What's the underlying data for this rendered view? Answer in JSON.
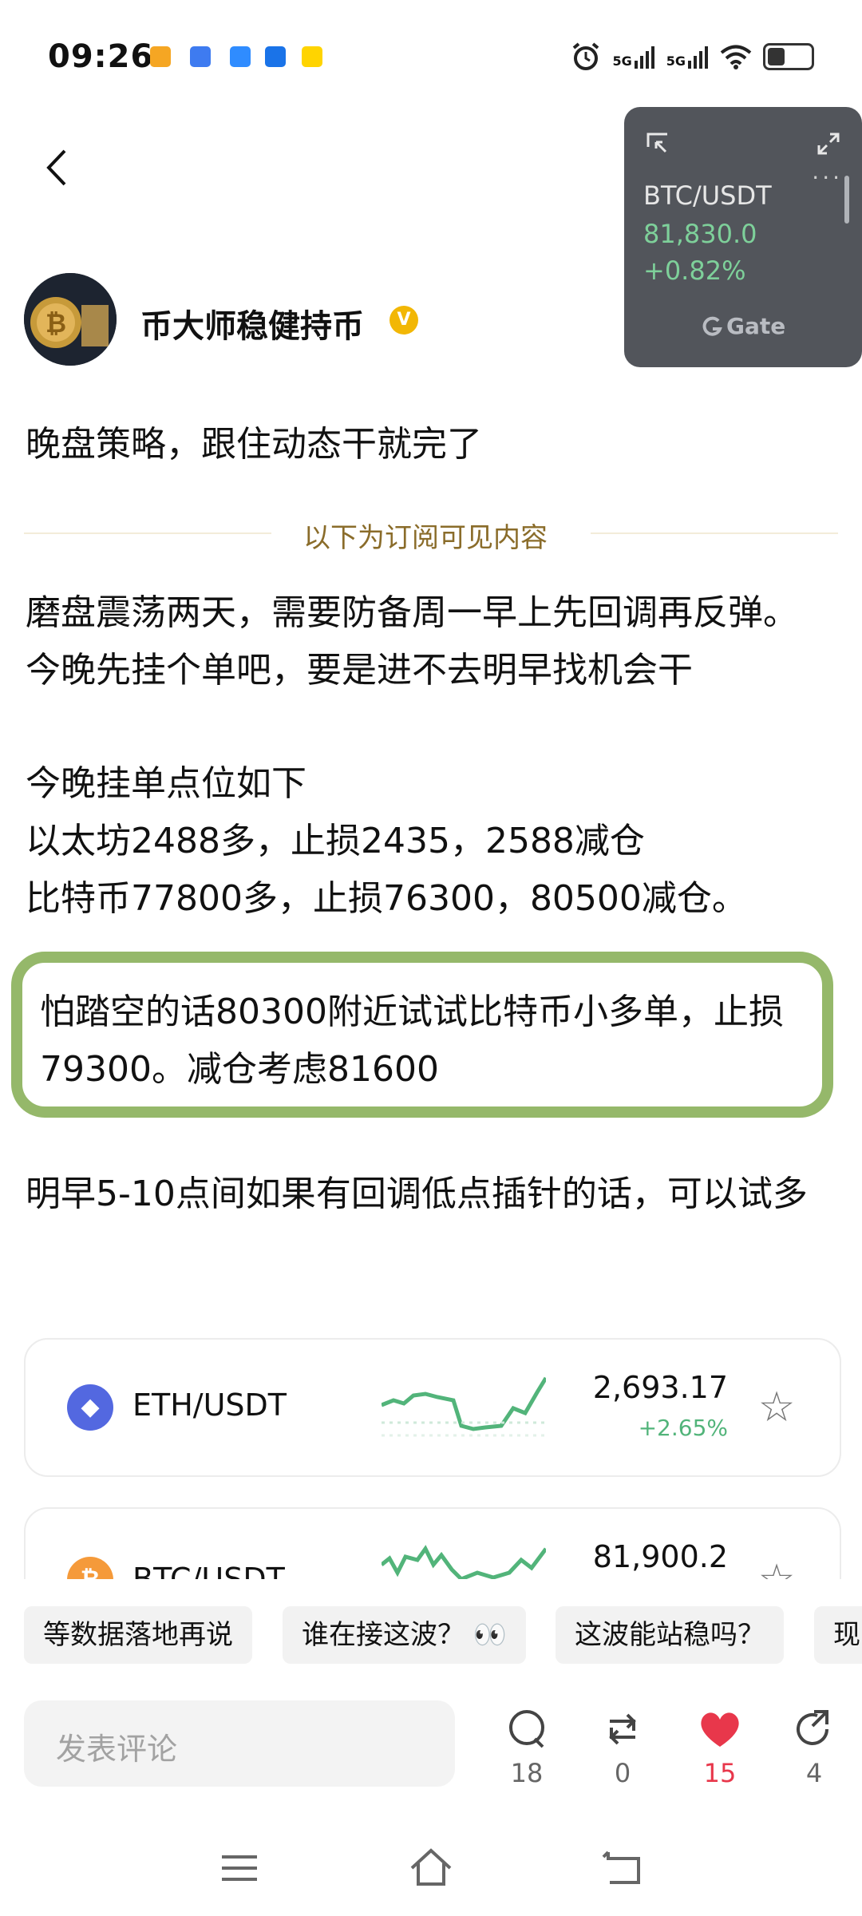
{
  "status_bar": {
    "time": "09:26",
    "signal1": "5G",
    "signal2": "5G",
    "app_icon_colors": [
      "#f5a623",
      "#3e7bf0",
      "#2f8cff",
      "#1a73e8",
      "#ffd400"
    ]
  },
  "header": {
    "back": "<",
    "author_name": "币大师稳健持币",
    "verified": "V"
  },
  "ticker_widget": {
    "pair": "BTC/USDT",
    "price": "81,830.0",
    "change": "+0.82%",
    "brand": "Gate"
  },
  "post": {
    "title": "晚盘策略，跟住动态干就完了",
    "divider": "以下为订阅可见内容",
    "para1": "磨盘震荡两天，需要防备周一早上先回调再反弹。今晚先挂个单吧，要是进不去明早找机会干",
    "line2": "今晚挂单点位如下",
    "line3": "以太坊2488多，止损2435，2588减仓",
    "line4": "比特币77800多，止损76300，80500减仓。",
    "highlight": "怕踏空的话80300附近试试比特币小多单，止损\n79300。减仓考虑81600",
    "para_last": "明早5-10点间如果有回调低点插针的话，可以试多"
  },
  "markets": [
    {
      "pair": "ETH/USDT",
      "price": "2,693.17",
      "change": "+2.65%",
      "icon_color": "#5368e0",
      "icon_glyph": "◆"
    },
    {
      "pair": "BTC/USDT",
      "price": "81,900.2",
      "change": "",
      "icon_color": "#f59a3a",
      "icon_glyph": "₿"
    }
  ],
  "quick_replies": [
    "等数据落地再说",
    "谁在接这波？ 👀",
    "这波能站稳吗？",
    "现"
  ],
  "comment": {
    "placeholder": "发表评论"
  },
  "actions": {
    "comments": "18",
    "reposts": "0",
    "likes": "15",
    "shares": "4",
    "like_color": "#e8374b"
  }
}
